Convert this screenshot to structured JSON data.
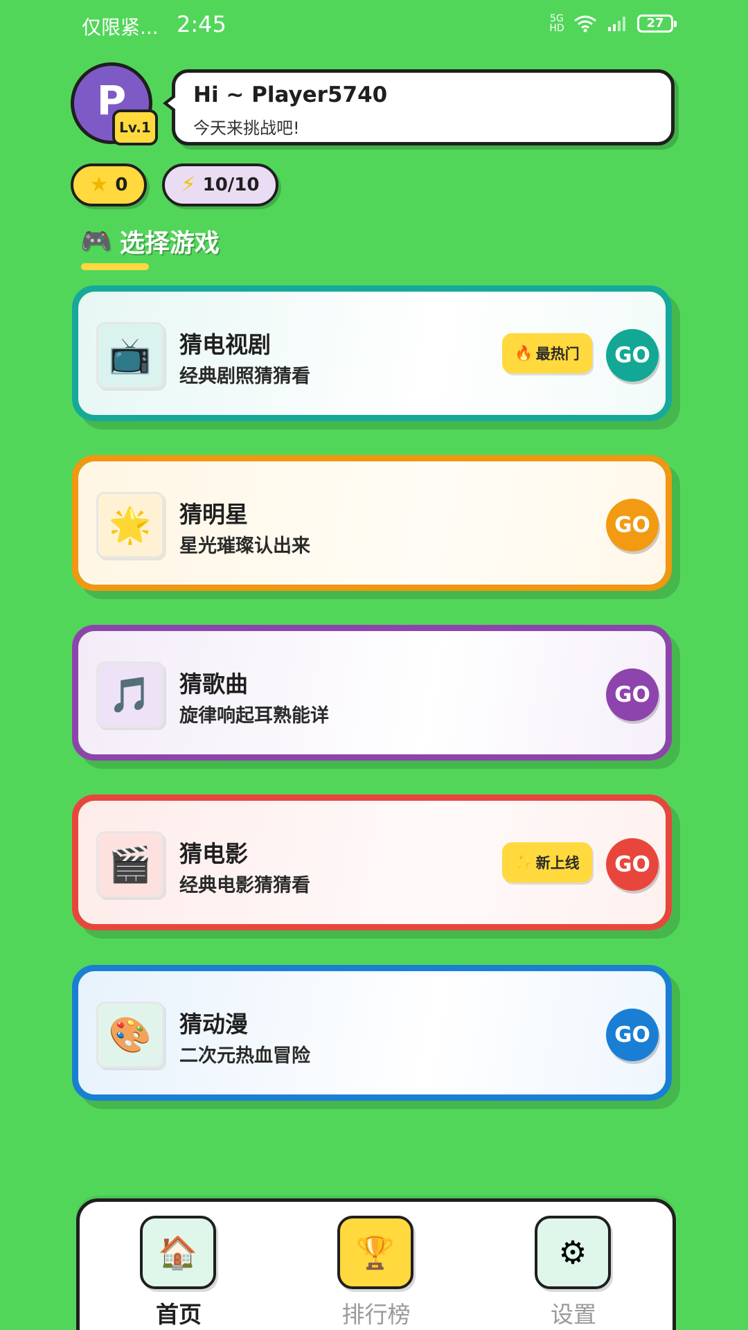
{
  "status_bar": {
    "carrier": "仅限紧...",
    "time": "2:45",
    "network": "5G HD",
    "battery": "27"
  },
  "header": {
    "avatar_letter": "P",
    "level": "Lv.1",
    "greeting": "Hi ~ Player5740",
    "subtitle": "今天来挑战吧!"
  },
  "stats": {
    "stars": "0",
    "energy": "10/10"
  },
  "section": {
    "title": "选择游戏"
  },
  "games": [
    {
      "title": "猜电视剧",
      "subtitle": "经典剧照猜猜看",
      "badge": "最热门",
      "badge_icon": "fire-icon",
      "icon": "tv-icon",
      "go": "GO",
      "accent": "#16a89a"
    },
    {
      "title": "猜明星",
      "subtitle": "星光璀璨认出来",
      "icon": "star-icon",
      "go": "GO",
      "accent": "#f39610"
    },
    {
      "title": "猜歌曲",
      "subtitle": "旋律响起耳熟能详",
      "icon": "music-note-icon",
      "go": "GO",
      "accent": "#8d44ad"
    },
    {
      "title": "猜电影",
      "subtitle": "经典电影猜猜看",
      "badge": "新上线",
      "badge_icon": "sparkle-icon",
      "icon": "clapperboard-icon",
      "go": "GO",
      "accent": "#e8463c"
    },
    {
      "title": "猜动漫",
      "subtitle": "二次元热血冒险",
      "icon": "palette-icon",
      "go": "GO",
      "accent": "#1a7fd4"
    }
  ],
  "nav": {
    "home": "首页",
    "rank": "排行榜",
    "settings": "设置"
  },
  "colors": {
    "background": "#52d65a",
    "highlight": "#ffd93d"
  }
}
